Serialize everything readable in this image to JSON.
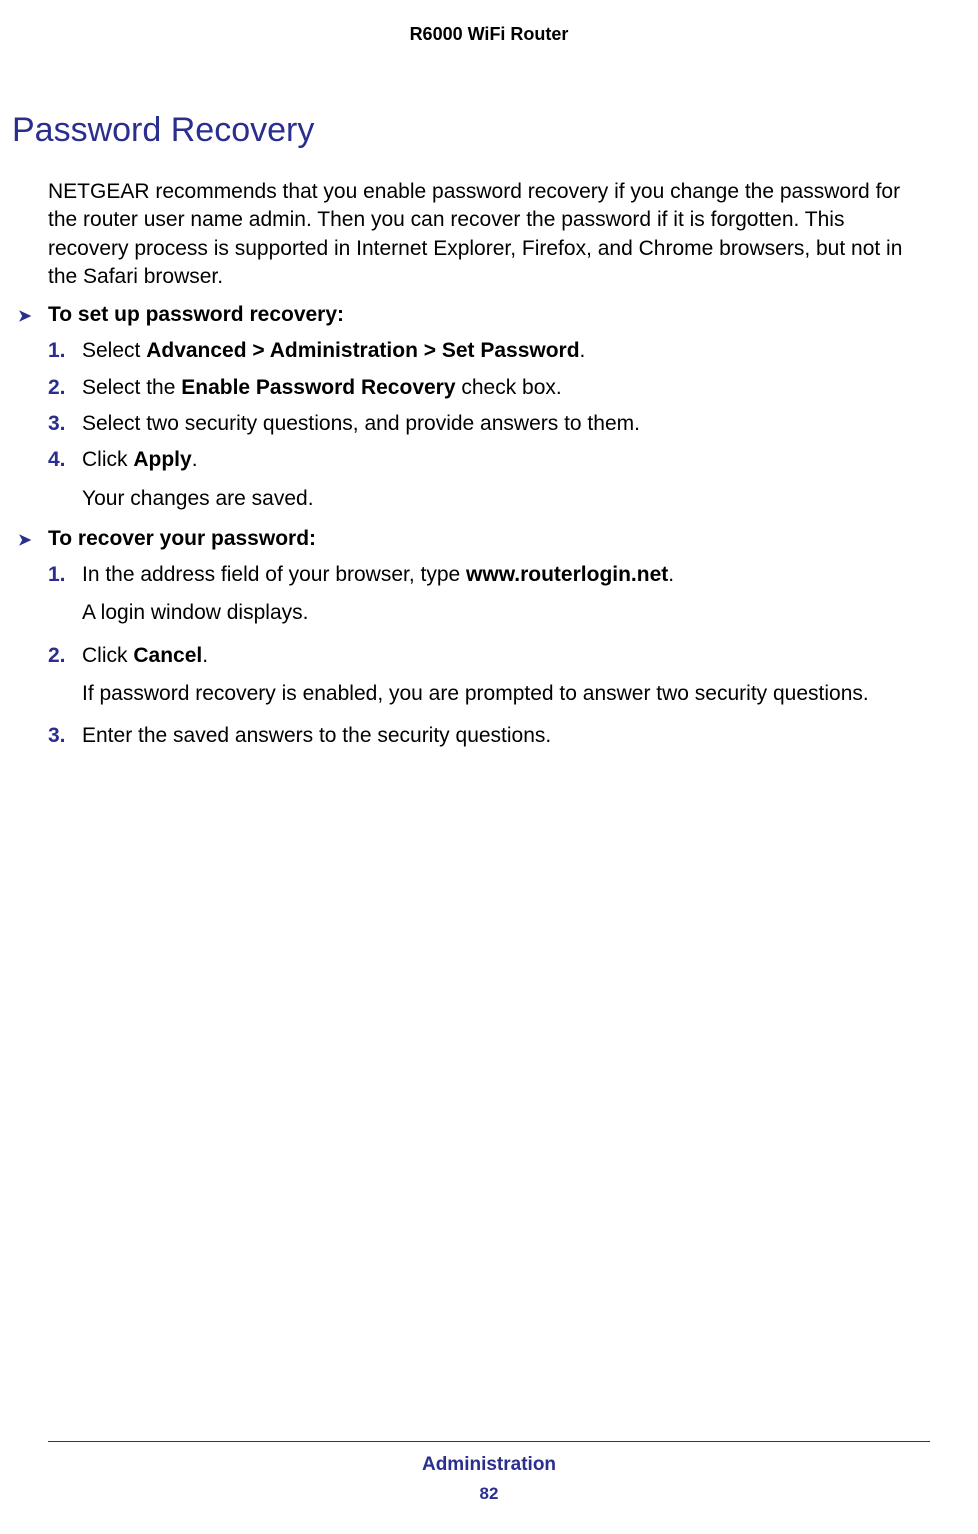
{
  "header": {
    "product": "R6000 WiFi Router"
  },
  "section": {
    "heading": "Password Recovery",
    "intro": "NETGEAR recommends that you enable password recovery if you change the password for the router user name admin. Then you can recover the password if it is forgotten. This recovery process is supported in Internet Explorer, Firefox, and Chrome browsers, but not in the Safari browser."
  },
  "tasks": [
    {
      "title": "To set up password recovery:",
      "steps": [
        {
          "num": "1.",
          "prefix": "Select ",
          "bold": "Advanced > Administration > Set Password",
          "suffix": ".",
          "result": ""
        },
        {
          "num": "2.",
          "prefix": "Select the ",
          "bold": "Enable Password Recovery",
          "suffix": " check box.",
          "result": ""
        },
        {
          "num": "3.",
          "prefix": "Select two security questions, and provide answers to them.",
          "bold": "",
          "suffix": "",
          "result": ""
        },
        {
          "num": "4.",
          "prefix": "Click ",
          "bold": "Apply",
          "suffix": ".",
          "result": "Your changes are saved."
        }
      ]
    },
    {
      "title": "To recover your password:",
      "steps": [
        {
          "num": "1.",
          "prefix": "In the address field of your browser, type ",
          "bold": "www.routerlogin.net",
          "suffix": ".",
          "result": "A login window displays."
        },
        {
          "num": "2.",
          "prefix": "Click ",
          "bold": "Cancel",
          "suffix": ".",
          "result": "If password recovery is enabled, you are prompted to answer two security questions."
        },
        {
          "num": "3.",
          "prefix": "Enter the saved answers to the security questions.",
          "bold": "",
          "suffix": "",
          "result": ""
        }
      ]
    }
  ],
  "footer": {
    "section": "Administration",
    "page": "82"
  }
}
